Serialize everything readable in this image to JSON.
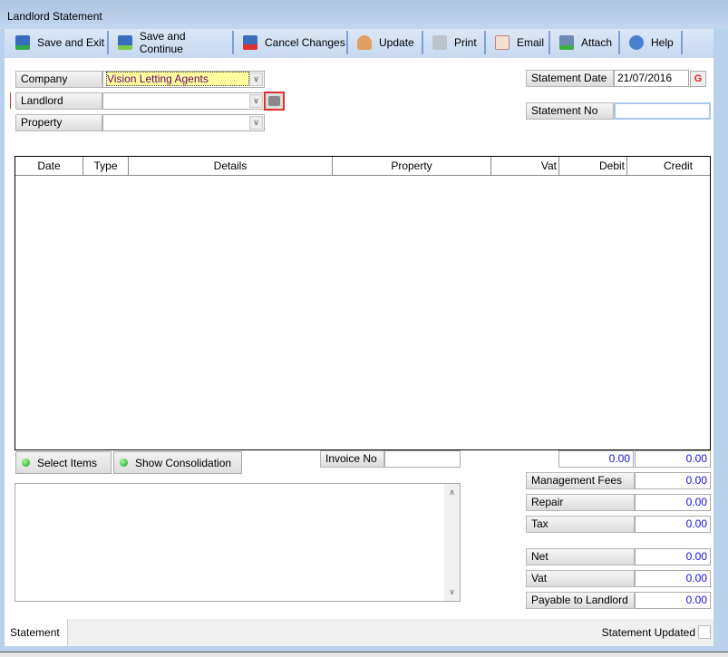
{
  "window": {
    "title": "Landlord Statement"
  },
  "toolbar": [
    {
      "label": "Save and Exit",
      "icon": "save-exit-icon"
    },
    {
      "label": "Save and Continue",
      "icon": "save-continue-icon"
    },
    {
      "label": "Cancel Changes",
      "icon": "cancel-icon"
    },
    {
      "label": "Update",
      "icon": "update-user-icon"
    },
    {
      "label": "Print",
      "icon": "printer-icon"
    },
    {
      "label": "Email",
      "icon": "email-icon"
    },
    {
      "label": "Attach",
      "icon": "attach-icon"
    },
    {
      "label": "Help",
      "icon": "help-icon"
    }
  ],
  "form": {
    "company_label": "Company",
    "company_value": "Vision Letting Agents",
    "landlord_label": "Landlord",
    "landlord_value": "",
    "property_label": "Property",
    "property_value": "",
    "statement_date_label": "Statement Date",
    "statement_date_value": "21/07/2016",
    "statement_no_label": "Statement No",
    "statement_no_value": ""
  },
  "grid": {
    "columns": [
      "Date",
      "Type",
      "Details",
      "Property",
      "Vat",
      "Debit",
      "Credit"
    ],
    "rows": []
  },
  "actions": {
    "select_items": "Select Items",
    "show_consolidation": "Show Consolidation",
    "invoice_no_label": "Invoice No",
    "invoice_no_value": ""
  },
  "totals": {
    "debit_total": "0.00",
    "credit_total": "0.00",
    "rows": [
      {
        "label": "Management Fees",
        "value": "0.00"
      },
      {
        "label": "Repair",
        "value": "0.00"
      },
      {
        "label": "Tax",
        "value": "0.00"
      },
      {
        "label": "Net",
        "value": "0.00"
      },
      {
        "label": "Vat",
        "value": "0.00"
      },
      {
        "label": "Payable to Landlord",
        "value": "0.00"
      }
    ]
  },
  "footer": {
    "tab": "Statement",
    "status_label": "Statement Updated",
    "status_checked": false
  },
  "colors": {
    "accent": "#1010e0",
    "company_bg": "#ffffa0",
    "required_marker": "#e03030"
  }
}
